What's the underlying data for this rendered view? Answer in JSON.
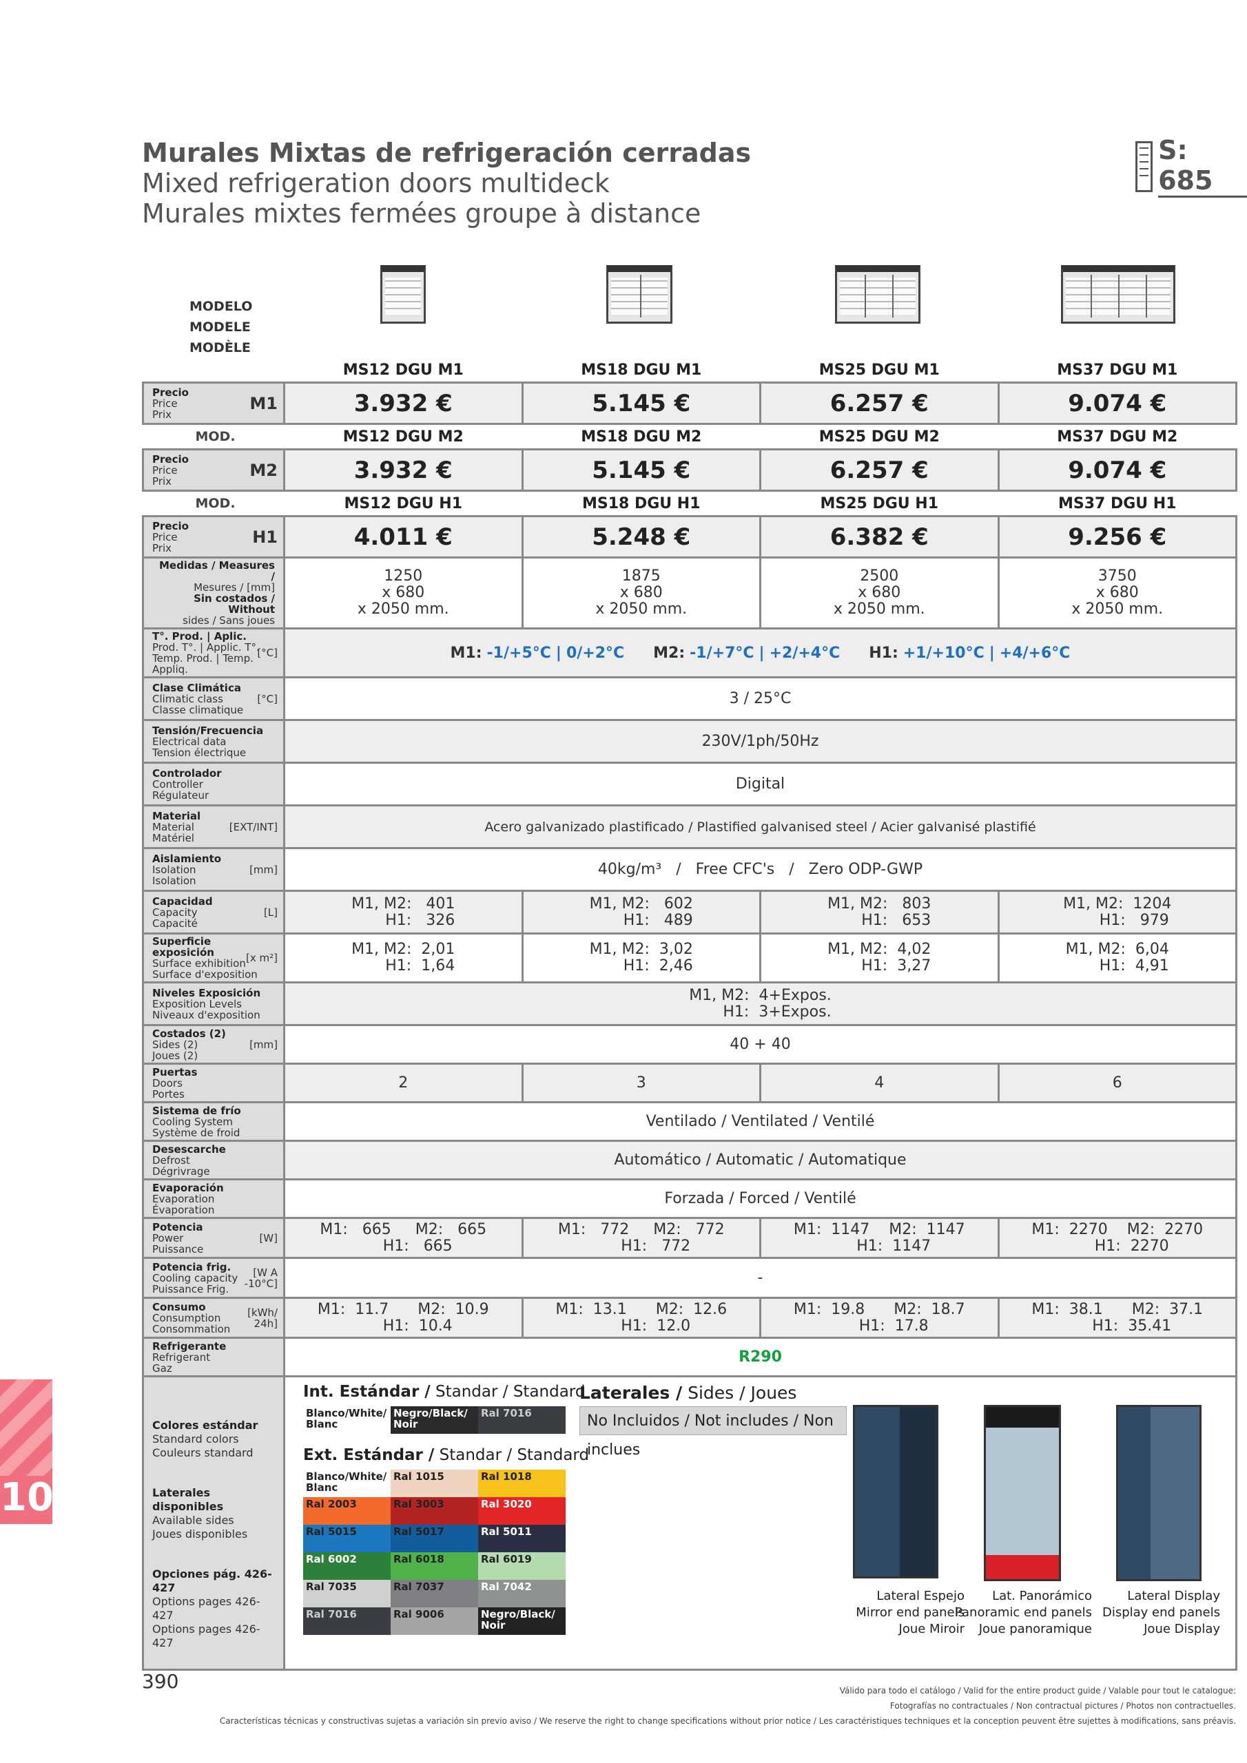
{
  "title": {
    "es": "Murales Mixtas de refrigeración cerradas",
    "en": "Mixed refrigeration doors multideck",
    "fr": "Murales mixtes fermées groupe à distance"
  },
  "badge": "S: 685",
  "header": {
    "modelo": "MODELO",
    "modele1": "MODELE",
    "modele2": "MODÈLE",
    "mod": "MOD."
  },
  "models": {
    "m1": [
      "MS12 DGU M1",
      "MS18 DGU M1",
      "MS25 DGU M1",
      "MS37 DGU M1"
    ],
    "m2": [
      "MS12 DGU M2",
      "MS18 DGU M2",
      "MS25 DGU M2",
      "MS37 DGU M2"
    ],
    "h1": [
      "MS12 DGU H1",
      "MS18 DGU H1",
      "MS25 DGU H1",
      "MS37 DGU H1"
    ]
  },
  "price_label": {
    "es": "Precio",
    "en": "Price",
    "fr": "Prix"
  },
  "variant": {
    "m1": "M1",
    "m2": "M2",
    "h1": "H1"
  },
  "prices": {
    "m1": [
      "3.932 €",
      "5.145 €",
      "6.257 €",
      "9.074 €"
    ],
    "m2": [
      "3.932 €",
      "5.145 €",
      "6.257 €",
      "9.074 €"
    ],
    "h1": [
      "4.011 €",
      "5.248 €",
      "6.382 €",
      "9.256 €"
    ]
  },
  "labels": {
    "measures": {
      "a": "Medidas / Measures /",
      "b": "Mesures / [mm]",
      "c": "Sin costados / Without",
      "d": "sides / Sans joues"
    },
    "temp": {
      "a": "T°. Prod. | Aplic.",
      "b": "Prod. T°. | Applic. T°.",
      "c": "Temp. Prod. | Temp. Appliq.",
      "u": "[°C]"
    },
    "climate": {
      "a": "Clase Climática",
      "b": "Climatic class",
      "c": "Classe climatique",
      "u": "[°C]"
    },
    "electrical": {
      "a": "Tensión/Frecuencia",
      "b": "Electrical data",
      "c": "Tension électrique"
    },
    "controller": {
      "a": "Controlador",
      "b": "Controller",
      "c": "Régulateur"
    },
    "material": {
      "a": "Material",
      "b": "Material",
      "c": "Matériel",
      "u": "[EXT/INT]"
    },
    "isolation": {
      "a": "Aislamiento",
      "b": "Isolation",
      "c": "Isolation",
      "u": "[mm]"
    },
    "capacity": {
      "a": "Capacidad",
      "b": "Capacity",
      "c": "Capacité",
      "u": "[L]"
    },
    "surface": {
      "a": "Superficie exposición",
      "b": "Surface exhibition",
      "c": "Surface d'exposition",
      "u": "[x m²]"
    },
    "levels": {
      "a": "Niveles Exposición",
      "b": "Exposition Levels",
      "c": "Niveaux d'exposition"
    },
    "sides": {
      "a": "Costados (2)",
      "b": "Sides (2)",
      "c": "Joues (2)",
      "u": "[mm]"
    },
    "doors": {
      "a": "Puertas",
      "b": "Doors",
      "c": "Portes"
    },
    "cooling": {
      "a": "Sistema de frío",
      "b": "Cooling System",
      "c": "Système de froid"
    },
    "defrost": {
      "a": "Desescarche",
      "b": "Defrost",
      "c": "Dégrivrage"
    },
    "evaporation": {
      "a": "Evaporación",
      "b": "Evaporation",
      "c": "Évaporation"
    },
    "power": {
      "a": "Potencia",
      "b": "Power",
      "c": "Puissance",
      "u": "[W]"
    },
    "coolcap": {
      "a": "Potencia frig.",
      "b": "Cooling capacity",
      "c": "Puissance Frig.",
      "u1": "[W A",
      "u2": "-10°C]"
    },
    "consumption": {
      "a": "Consumo",
      "b": "Consumption",
      "c": "Consommation",
      "u1": "[kWh/",
      "u2": "24h]"
    },
    "refrigerant": {
      "a": "Refrigerante",
      "b": "Refrigerant",
      "c": "Gaz"
    },
    "colors": {
      "a": "Colores estándar",
      "b": "Standard colors",
      "c": "Couleurs standard"
    },
    "sidesavail": {
      "a": "Laterales disponibles",
      "b": "Available sides",
      "c": "Joues disponibles"
    },
    "options": {
      "a": "Opciones pág. 426-427",
      "b": "Options pages 426-427",
      "c": "Options pages 426-427"
    }
  },
  "measures": [
    "1250\nx 680\nx 2050 mm.",
    "1875\nx 680\nx 2050 mm.",
    "2500\nx 680\nx 2050 mm.",
    "3750\nx 680\nx 2050 mm."
  ],
  "temp": {
    "m1k": "M1:",
    "m1a": "-1/+5°C",
    "m1b": "0/+2°C",
    "m2k": "M2:",
    "m2a": "-1/+7°C",
    "m2b": "+2/+4°C",
    "h1k": "H1:",
    "h1a": "+1/+10°C",
    "h1b": "+4/+6°C",
    "sep": "|"
  },
  "climate": "3 / 25°C",
  "electrical": "230V/1ph/50Hz",
  "controller": "Digital",
  "material": "Acero galvanizado plastificado / Plastified galvanised steel / Acier galvanisé plastifié",
  "isolation": {
    "a": "40kg/m³",
    "sep": "/",
    "b": "Free CFC's",
    "c": "Zero ODP-GWP"
  },
  "capacity": [
    "M1, M2:   401\n       H1:   326",
    "M1, M2:   602\n       H1:   489",
    "M1, M2:   803\n       H1:   653",
    "M1, M2:  1204\n       H1:   979"
  ],
  "surface": [
    "M1, M2:  2,01\n       H1:  1,64",
    "M1, M2:  3,02\n       H1:  2,46",
    "M1, M2:  4,02\n       H1:  3,27",
    "M1, M2:  6,04\n       H1:  4,91"
  ],
  "levels": "M1, M2:  4+Expos.\n       H1:  3+Expos.",
  "sides": "40 + 40",
  "doors": [
    "2",
    "3",
    "4",
    "6"
  ],
  "cooling": "Ventilado / Ventilated / Ventilé",
  "defrost": "Automático / Automatic / Automatique",
  "evaporation": "Forzada / Forced / Ventilé",
  "power": [
    "M1:   665     M2:   665\n      H1:   665",
    "M1:   772     M2:   772\n      H1:   772",
    "M1:  1147    M2:  1147\n      H1:  1147",
    "M1:  2270    M2:  2270\n      H1:  2270"
  ],
  "coolcap": "-",
  "consumption": [
    "M1:  11.7      M2:  10.9\n      H1:  10.4",
    "M1:  13.1      M2:  12.6\n      H1:  12.0",
    "M1:  19.8      M2:  18.7\n      H1:  17.8",
    "M1:  38.1      M2:  37.1\n      H1:  35.41"
  ],
  "refrigerant": "R290",
  "int_std": {
    "es": "Int. Estándar /",
    "en": "Standar /",
    "fr": "Standard"
  },
  "ext_std": {
    "es": "Ext. Estándar /",
    "en": "Standar /",
    "fr": "Standard"
  },
  "laterales": {
    "es": "Laterales /",
    "en": "Sides /",
    "fr": "Joues"
  },
  "no_incluidos": "No Incluidos / Not includes / Non inclues",
  "int_colors": [
    {
      "label": "Blanco/White/ Blanc",
      "bg": "#ffffff",
      "fg": "#222222"
    },
    {
      "label": "Negro/Black/ Noir",
      "bg": "#2a2a2a",
      "fg": "#ffffff"
    },
    {
      "label": "Ral 7016",
      "bg": "#3a3d42",
      "fg": "#cccccc"
    }
  ],
  "ext_colors": [
    {
      "label": "Blanco/White/ Blanc",
      "bg": "#ffffff",
      "fg": "#222222"
    },
    {
      "label": "Ral 1015",
      "bg": "#f1d4c0",
      "fg": "#222222"
    },
    {
      "label": "Ral 1018",
      "bg": "#f7c21a",
      "fg": "#222222"
    },
    {
      "label": "Ral 2003",
      "bg": "#f26a2a",
      "fg": "#222222"
    },
    {
      "label": "Ral 3003",
      "bg": "#b22424",
      "fg": "#222222"
    },
    {
      "label": "Ral 3020",
      "bg": "#e42525",
      "fg": "#ffffff"
    },
    {
      "label": "Ral 5015",
      "bg": "#1b78bf",
      "fg": "#222222"
    },
    {
      "label": "Ral 5017",
      "bg": "#135d9c",
      "fg": "#222222"
    },
    {
      "label": "Ral 5011",
      "bg": "#2a2f45",
      "fg": "#ffffff"
    },
    {
      "label": "Ral 6002",
      "bg": "#2d7f3a",
      "fg": "#ffffff"
    },
    {
      "label": "Ral 6018",
      "bg": "#4fb24a",
      "fg": "#222222"
    },
    {
      "label": "Ral 6019",
      "bg": "#b4dcae",
      "fg": "#222222"
    },
    {
      "label": "Ral 7035",
      "bg": "#cfd1cf",
      "fg": "#222222"
    },
    {
      "label": "Ral 7037",
      "bg": "#7d7f82",
      "fg": "#222222"
    },
    {
      "label": "Ral 7042",
      "bg": "#8e9290",
      "fg": "#ffffff"
    },
    {
      "label": "Ral 7016",
      "bg": "#3a3d42",
      "fg": "#cccccc"
    },
    {
      "label": "Ral 9006",
      "bg": "#a5a5a5",
      "fg": "#222222"
    },
    {
      "label": "Negro/Black/ Noir",
      "bg": "#222222",
      "fg": "#ffffff"
    }
  ],
  "side_panels": [
    {
      "l1": "Lateral Espejo",
      "l2": "Mirror end panels",
      "l3": "Joue Miroir"
    },
    {
      "l1": "Lat. Panorámico",
      "l2": "Panoramic end panels",
      "l3": "Joue panoramique"
    },
    {
      "l1": "Lateral Display",
      "l2": "Display end panels",
      "l3": "Joue Display"
    }
  ],
  "tab_number": "10",
  "page_number": "390",
  "footer": {
    "l1": "Válido para todo el catálogo / Valid for the entire product guide / Valable pour tout le catalogue:",
    "l2": "Fotografías no contractuales / Non contractual pictures / Photos non contractuelles.",
    "l3": "Características técnicas y constructivas sujetas a variación sin previo aviso / We reserve the right to change specifications without prior notice / Les caractéristiques techniques et la conception peuvent être sujettes à modifications, sans préavis."
  },
  "colors": {
    "accent_blue": "#1f6fc3",
    "refrigerant_green": "#15a03e",
    "tab_pink": "#f07080",
    "label_grey": "#dddddd"
  }
}
